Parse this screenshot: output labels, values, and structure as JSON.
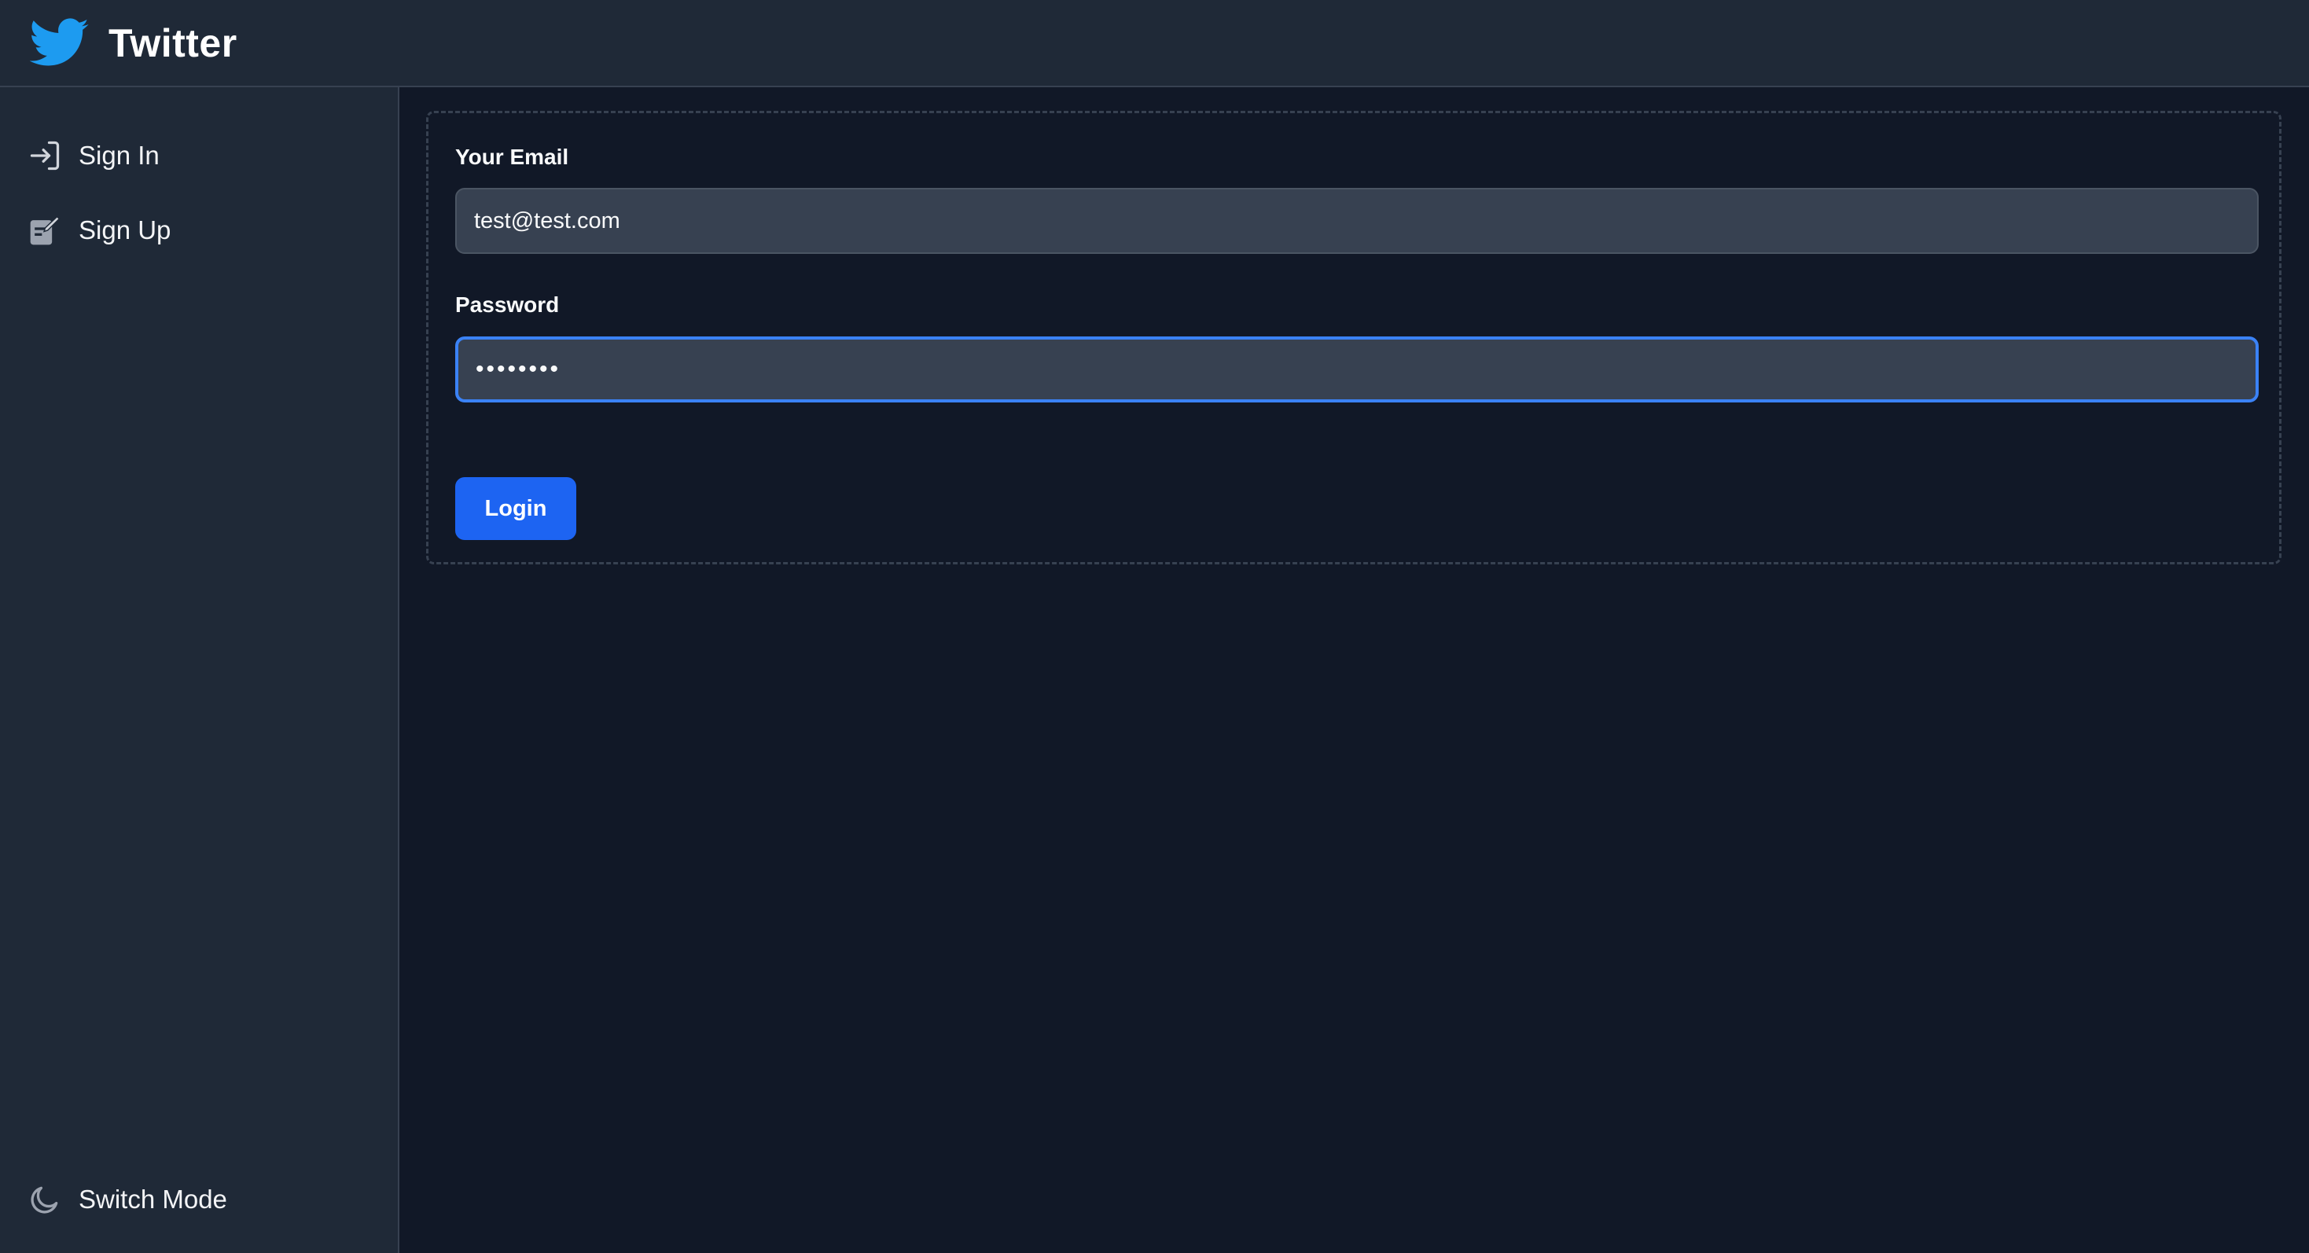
{
  "header": {
    "title": "Twitter",
    "logo_icon": "twitter-bird-icon",
    "logo_color": "#1d9bf0"
  },
  "sidebar": {
    "items": [
      {
        "label": "Sign In",
        "icon": "sign-in-icon"
      },
      {
        "label": "Sign Up",
        "icon": "sign-up-icon"
      }
    ],
    "switch_mode": {
      "label": "Switch Mode",
      "icon": "moon-icon"
    }
  },
  "form": {
    "email": {
      "label": "Your Email",
      "value": "test@test.com"
    },
    "password": {
      "label": "Password",
      "value": "password"
    },
    "submit_label": "Login"
  },
  "colors": {
    "accent": "#1d64f2",
    "focus_ring": "#3b82f6",
    "background": "#111827",
    "panel": "#1f2937"
  }
}
